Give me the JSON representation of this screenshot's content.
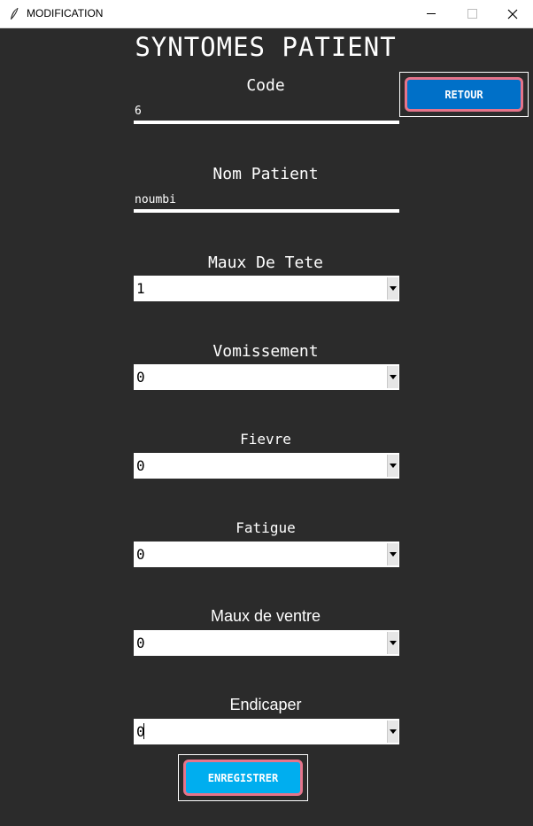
{
  "window": {
    "title": "MODIFICATION"
  },
  "heading": "SYNTOMES PATIENT",
  "fields": {
    "code": {
      "label": "Code",
      "value": "6"
    },
    "nom_patient": {
      "label": "Nom Patient",
      "value": "noumbi"
    },
    "maux_de_tete": {
      "label": "Maux De Tete",
      "value": "1"
    },
    "vomissement": {
      "label": "Vomissement",
      "value": "0"
    },
    "fievre": {
      "label": "Fievre",
      "value": "0"
    },
    "fatigue": {
      "label": "Fatigue",
      "value": "0"
    },
    "maux_de_ventre": {
      "label": "Maux de ventre",
      "value": "0"
    },
    "endicaper": {
      "label": "Endicaper",
      "value": "0"
    }
  },
  "buttons": {
    "retour": "RETOUR",
    "enregistrer": "ENREGISTRER"
  },
  "colors": {
    "background": "#2b2b2b",
    "retour_button": "#0070c8",
    "enregistrer_button": "#00aeef",
    "button_border": "#e6748a"
  }
}
